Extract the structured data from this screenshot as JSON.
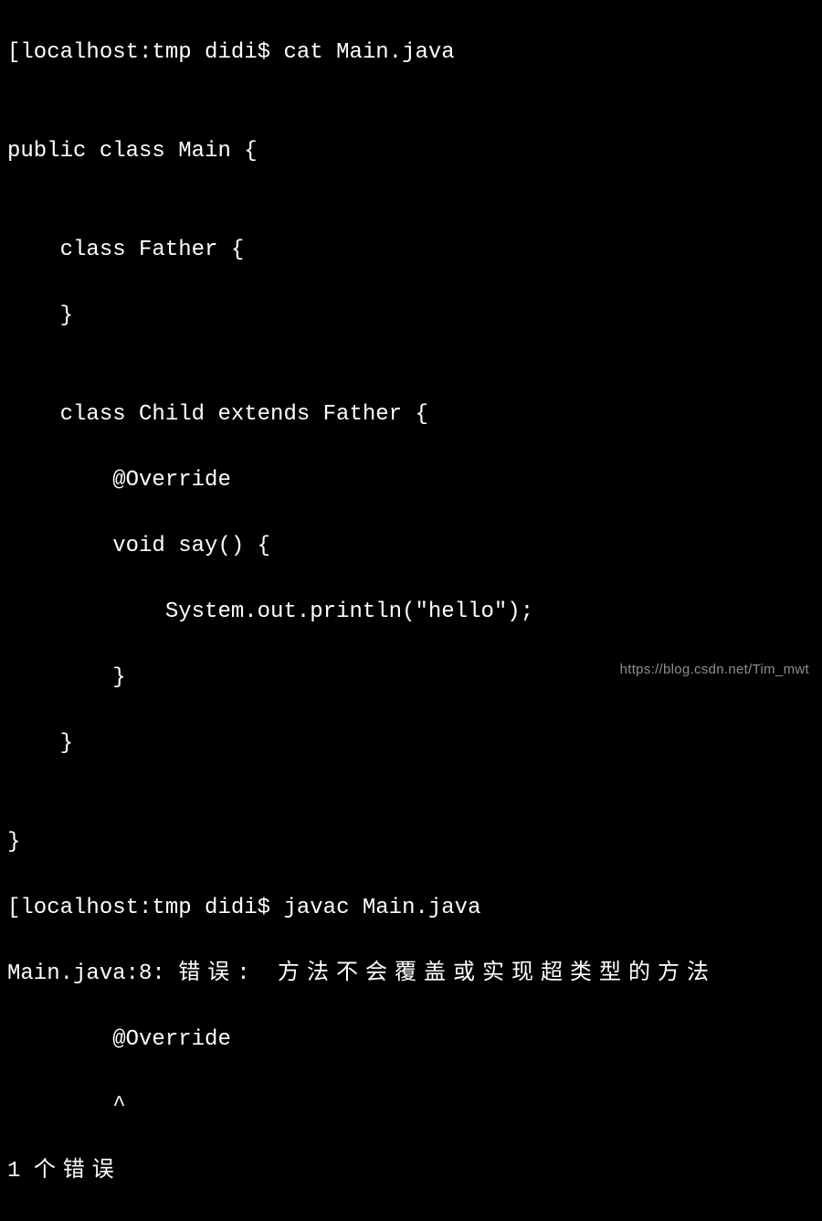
{
  "terminal": {
    "lines": [
      {
        "prefix": "[",
        "prompt": "localhost:tmp didi$ ",
        "command": "cat Main.java"
      },
      {
        "text": ""
      },
      {
        "text": "public class Main {"
      },
      {
        "text": ""
      },
      {
        "text": "    class Father {"
      },
      {
        "text": "    }"
      },
      {
        "text": ""
      },
      {
        "text": "    class Child extends Father {"
      },
      {
        "text": "        @Override"
      },
      {
        "text": "        void say() {"
      },
      {
        "text": "            System.out.println(\"hello\");"
      },
      {
        "text": "        }"
      },
      {
        "text": "    }"
      },
      {
        "text": ""
      },
      {
        "text": "}"
      },
      {
        "prefix": "[",
        "prompt": "localhost:tmp didi$ ",
        "command": "javac Main.java"
      },
      {
        "error_prefix": "Main.java:8: ",
        "error_label": "错误: ",
        "error_msg": "方法不会覆盖或实现超类型的方法"
      },
      {
        "text": "        @Override"
      },
      {
        "text": "        ^"
      },
      {
        "error_count": "1 ",
        "error_count_label": "个错误"
      }
    ]
  },
  "watermark": "https://blog.csdn.net/Tim_mwt"
}
